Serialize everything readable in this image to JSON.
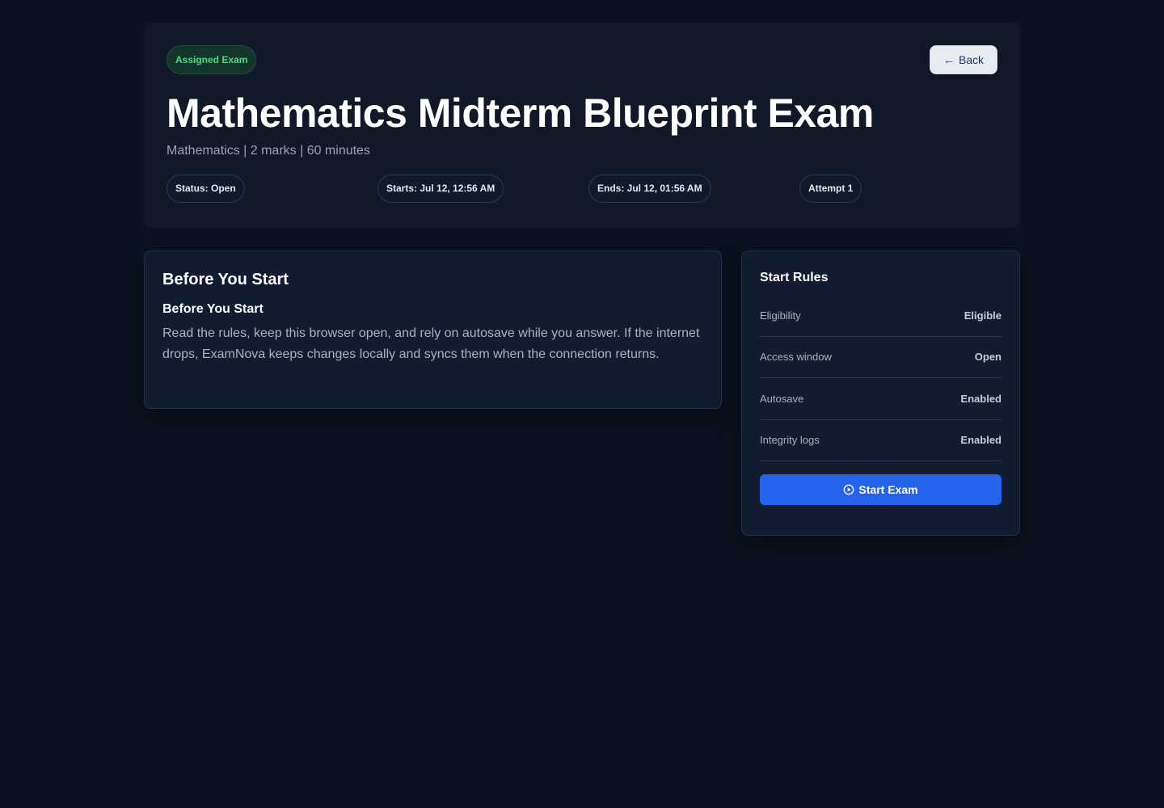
{
  "hero": {
    "badge": "Assigned Exam",
    "back_label": "Back",
    "title": "Mathematics Midterm Blueprint Exam",
    "subtitle": "Mathematics | 2 marks | 60 minutes",
    "pills": {
      "status": "Status: Open",
      "starts": "Starts: Jul 12, 12:56 AM",
      "ends": "Ends: Jul 12, 01:56 AM",
      "attempt": "Attempt 1"
    }
  },
  "before_card": {
    "heading": "Before You Start",
    "subheading": "Before You Start",
    "body": "Read the rules, keep this browser open, and rely on autosave while you answer. If the internet drops, ExamNova keeps changes locally and syncs them when the connection returns."
  },
  "rules_card": {
    "heading": "Start Rules",
    "rows": [
      {
        "label": "Eligibility",
        "value": "Eligible"
      },
      {
        "label": "Access window",
        "value": "Open"
      },
      {
        "label": "Autosave",
        "value": "Enabled"
      },
      {
        "label": "Integrity logs",
        "value": "Enabled"
      }
    ],
    "start_label": "Start Exam"
  },
  "icons": {
    "back": "arrow-left-icon",
    "start": "play-circle-icon"
  },
  "colors": {
    "background": "#0b111e",
    "accent": "#2563eb",
    "badge_green": "#4ade80"
  }
}
